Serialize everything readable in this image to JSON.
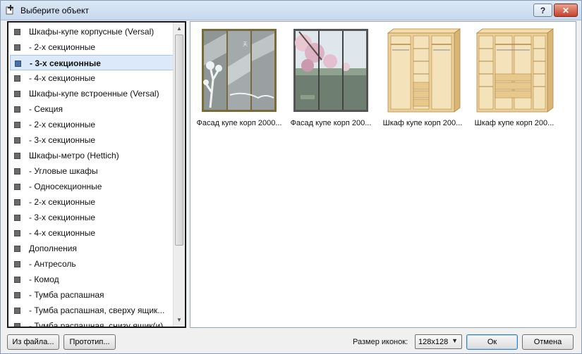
{
  "window": {
    "title": "Выберите объект",
    "help_label": "?",
    "close_label": "✕"
  },
  "tree": {
    "items": [
      {
        "label": "Шкафы-купе корпусные (Versal)",
        "selected": false
      },
      {
        "label": "-   2-х секционные",
        "selected": false
      },
      {
        "label": "-   3-х секционные",
        "selected": true
      },
      {
        "label": "-   4-х секционные",
        "selected": false
      },
      {
        "label": "Шкафы-купе встроенные (Versal)",
        "selected": false
      },
      {
        "label": "-    Секция",
        "selected": false
      },
      {
        "label": "-    2-х секционные",
        "selected": false
      },
      {
        "label": "-    3-х секционные",
        "selected": false
      },
      {
        "label": "Шкафы-метро (Hettich)",
        "selected": false
      },
      {
        "label": "-    Угловые шкафы",
        "selected": false
      },
      {
        "label": "-    Односекционные",
        "selected": false
      },
      {
        "label": "-    2-х секционные",
        "selected": false
      },
      {
        "label": "-    3-х секционные",
        "selected": false
      },
      {
        "label": "-    4-х секционные",
        "selected": false
      },
      {
        "label": "Дополнения",
        "selected": false
      },
      {
        "label": "-    Антресоль",
        "selected": false
      },
      {
        "label": "-    Комод",
        "selected": false
      },
      {
        "label": "-    Тумба распашная",
        "selected": false
      },
      {
        "label": "-    Тумба распашная, сверху ящик...",
        "selected": false
      },
      {
        "label": "-    Тумба распашная, снизу ящик(и)",
        "selected": false
      }
    ]
  },
  "gallery": {
    "items": [
      {
        "caption": "Фасад купе корп 2000...",
        "icon": "mirror-sakura-facade"
      },
      {
        "caption": "Фасад купе корп 200...",
        "icon": "photo-print-facade"
      },
      {
        "caption": "Шкаф купе корп 200...",
        "icon": "wardrobe-frame-3-section"
      },
      {
        "caption": "Шкаф купе корп 200...",
        "icon": "wardrobe-frame-4-section"
      }
    ]
  },
  "footer": {
    "from_file_label": "Из файла...",
    "prototype_label": "Прототип...",
    "icon_size_label": "Размер иконок:",
    "icon_size_value": "128x128",
    "ok_label": "Ок",
    "cancel_label": "Отмена"
  },
  "colors": {
    "selection": "#dbe9f9",
    "close_button": "#c7432c",
    "wood": "#e9c98f"
  }
}
